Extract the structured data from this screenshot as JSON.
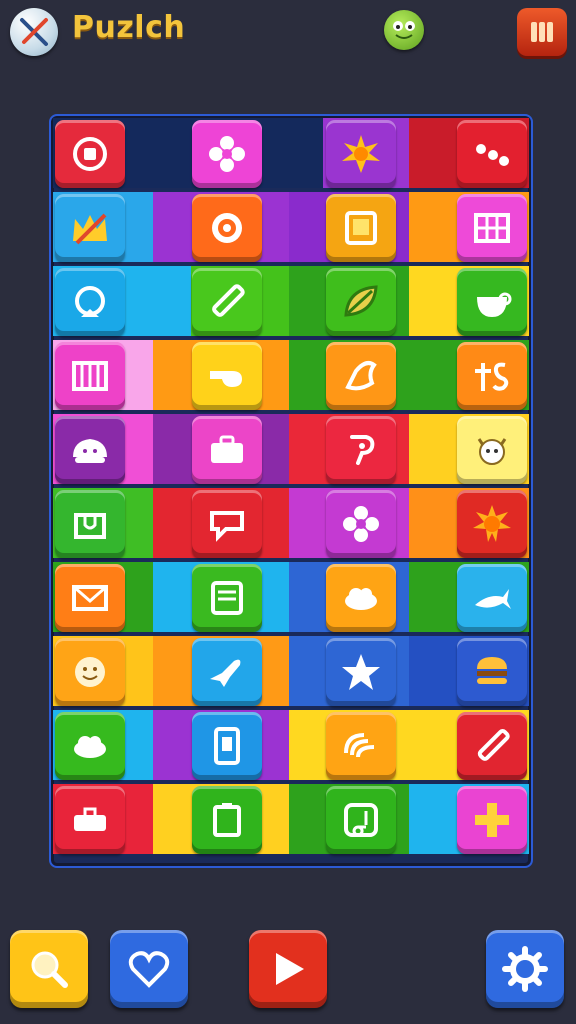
{
  "header": {
    "title": "Puzlch",
    "logo_icon": "crossed-swords-icon",
    "mascot_icon": "frog-face-icon",
    "pause_icon": "pause-icon"
  },
  "board": {
    "rows": [
      [
        {
          "icon": "target-square-icon",
          "color": "#e52a3c"
        },
        {
          "icon": "flower-icon",
          "color": "#ee44d6"
        },
        {
          "icon": "sun-icon",
          "color": "#9a35d0"
        },
        {
          "icon": "dots-icon",
          "color": "#e3202f"
        }
      ],
      [
        {
          "icon": "crown-icon",
          "color": "#2aa7ea"
        },
        {
          "icon": "flower-ring-icon",
          "color": "#ff6a1a"
        },
        {
          "icon": "picture-frame-icon",
          "color": "#f5a512"
        },
        {
          "icon": "grid-icon",
          "color": "#ee4ad8"
        }
      ],
      [
        {
          "icon": "refresh-icon",
          "color": "#1aa8e8"
        },
        {
          "icon": "pencil-icon",
          "color": "#49c81d"
        },
        {
          "icon": "leaf-icon",
          "color": "#3fbe1c"
        },
        {
          "icon": "bowl-icon",
          "color": "#36b820"
        }
      ],
      [
        {
          "icon": "fence-icon",
          "color": "#ee42c8"
        },
        {
          "icon": "whistle-icon",
          "color": "#ffd21a"
        },
        {
          "icon": "bird-icon",
          "color": "#ff9716"
        },
        {
          "icon": "symbol-icon",
          "color": "#ff8a16"
        }
      ],
      [
        {
          "icon": "bun-icon",
          "color": "#8a2aa8"
        },
        {
          "icon": "briefcase-icon",
          "color": "#ec45c8"
        },
        {
          "icon": "hook-icon",
          "color": "#ec2740"
        },
        {
          "icon": "goat-icon",
          "color": "#fff07a"
        }
      ],
      [
        {
          "icon": "house-icon",
          "color": "#34b62e"
        },
        {
          "icon": "note-icon",
          "color": "#e32630"
        },
        {
          "icon": "flower-icon",
          "color": "#c43ad2"
        },
        {
          "icon": "sun-face-icon",
          "color": "#e02a24"
        }
      ],
      [
        {
          "icon": "mail-icon",
          "color": "#ff7e16"
        },
        {
          "icon": "card-icon",
          "color": "#3aba20"
        },
        {
          "icon": "cloud-icon",
          "color": "#ffa414"
        },
        {
          "icon": "fish-icon",
          "color": "#2ab2ec"
        }
      ],
      [
        {
          "icon": "smiley-icon",
          "color": "#ffa416"
        },
        {
          "icon": "plane-icon",
          "color": "#22a6ea"
        },
        {
          "icon": "star-icon",
          "color": "#2e66d4"
        },
        {
          "icon": "burger-icon",
          "color": "#2d5ad0"
        }
      ],
      [
        {
          "icon": "cloud-icon",
          "color": "#36ba1e"
        },
        {
          "icon": "phone-icon",
          "color": "#1f96e6"
        },
        {
          "icon": "wifi-icon",
          "color": "#ffa414"
        },
        {
          "icon": "pencil-icon",
          "color": "#e12530"
        }
      ],
      [
        {
          "icon": "bag-icon",
          "color": "#e8243a"
        },
        {
          "icon": "clipboard-icon",
          "color": "#30b41c"
        },
        {
          "icon": "music-note-icon",
          "color": "#30b41c"
        },
        {
          "icon": "plus-icon",
          "color": "#ea44d2"
        }
      ]
    ]
  },
  "bottom_bar": {
    "buttons": [
      {
        "icon": "magnifier-icon",
        "color": "#ffc417"
      },
      {
        "icon": "heart-icon",
        "color": "#2f6ae0"
      },
      {
        "icon": "play-icon",
        "color": "#e2301e"
      },
      {
        "icon": "gear-icon",
        "color": "#2f6ae0"
      }
    ]
  }
}
